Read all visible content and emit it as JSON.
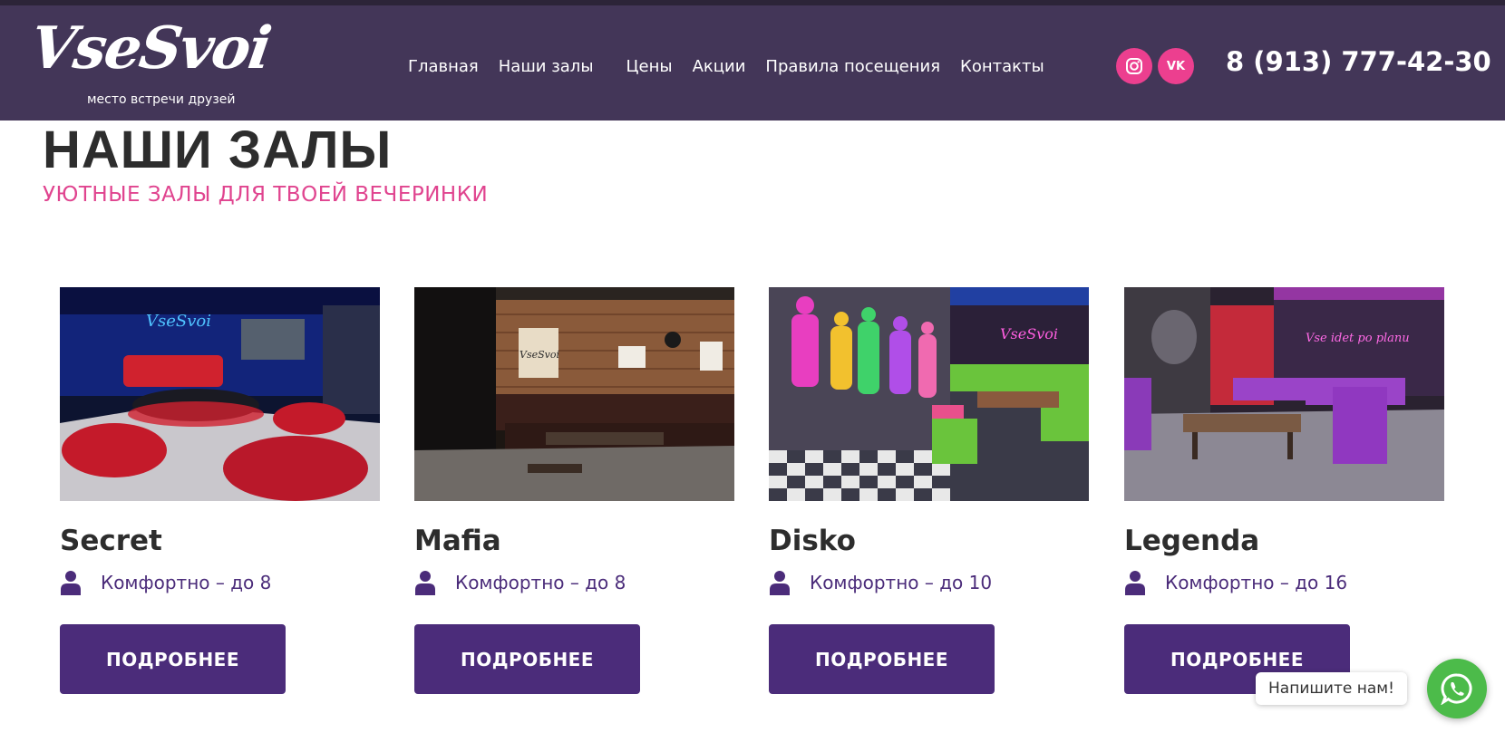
{
  "header": {
    "logo_text": "VseSvoi",
    "logo_tagline": "место встречи друзей",
    "nav": [
      {
        "label": "Главная"
      },
      {
        "label": "Наши залы"
      },
      {
        "label": "Цены"
      },
      {
        "label": "Акции"
      },
      {
        "label": "Правила посещения"
      },
      {
        "label": "Контакты"
      }
    ],
    "social": [
      {
        "name": "instagram-icon"
      },
      {
        "name": "vk-icon",
        "label": "VK"
      }
    ],
    "phone": "8 (913) 777-42-30",
    "colors": {
      "background": "#433658",
      "social": "#ec3f8f"
    }
  },
  "main": {
    "title": "НАШИ ЗАЛЫ",
    "subtitle": "УЮТНЫЕ ЗАЛЫ ДЛЯ ТВОЕЙ ВЕЧЕРИНКИ",
    "colors": {
      "accent": "#e0448f",
      "button": "#4b2c7a"
    },
    "halls": [
      {
        "name": "Secret",
        "capacity": "Комфортно – до 8",
        "button": "ПОДРОБНЕЕ",
        "neon_sign": "VseSvoi"
      },
      {
        "name": "Mafia",
        "capacity": "Комфортно – до 8",
        "button": "ПОДРОБНЕЕ",
        "neon_sign": "VseSvoi"
      },
      {
        "name": "Disko",
        "capacity": "Комфортно – до 10",
        "button": "ПОДРОБНЕЕ",
        "neon_sign": "VseSvoi"
      },
      {
        "name": "Legenda",
        "capacity": "Комфортно – до 16",
        "button": "ПОДРОБНЕЕ",
        "neon_sign": "Vse idet po planu"
      }
    ]
  },
  "chat": {
    "label": "Напишите нам!",
    "icon": "whatsapp-icon",
    "color": "#4cbb4a"
  }
}
